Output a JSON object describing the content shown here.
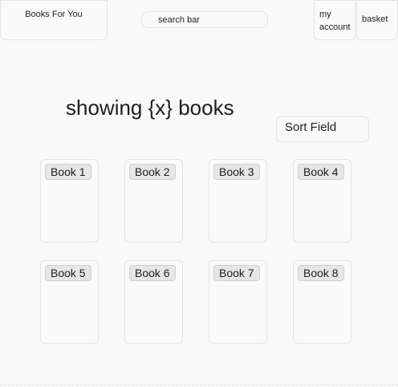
{
  "header": {
    "brand": "Books For You",
    "search_placeholder": "search bar",
    "account_label": "my account",
    "basket_label": "basket"
  },
  "main": {
    "heading": "showing {x} books",
    "sort_label": "Sort Field",
    "books": [
      {
        "label": "Book 1"
      },
      {
        "label": "Book 2"
      },
      {
        "label": "Book 3"
      },
      {
        "label": "Book 4"
      },
      {
        "label": "Book 5"
      },
      {
        "label": "Book 6"
      },
      {
        "label": "Book 7"
      },
      {
        "label": "Book 8"
      }
    ]
  }
}
